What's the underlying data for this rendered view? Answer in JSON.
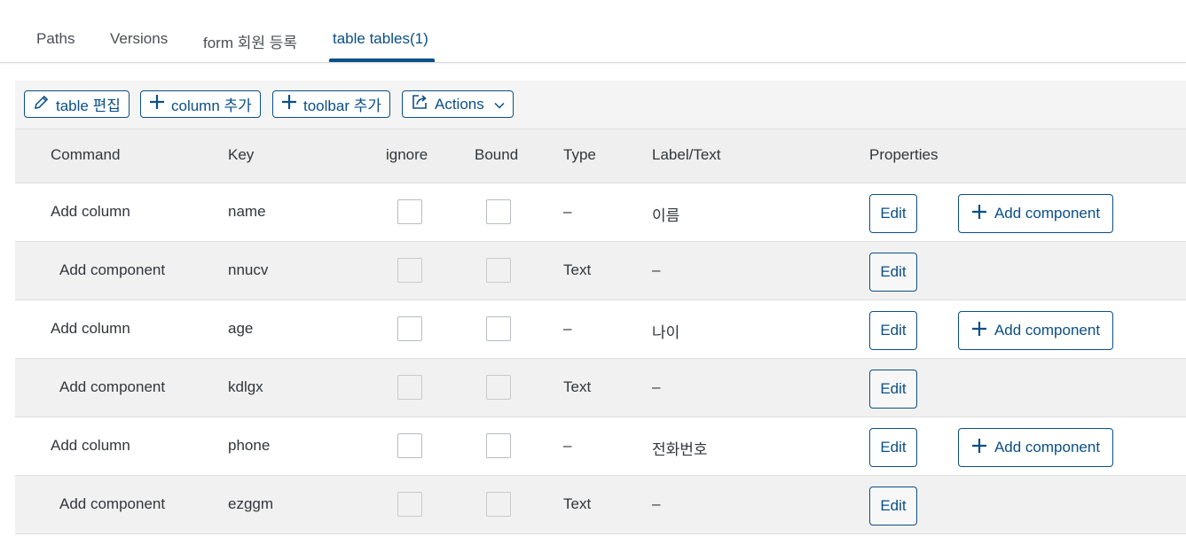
{
  "tabs": [
    {
      "label": "Paths",
      "selected": false
    },
    {
      "label": "Versions",
      "selected": false
    },
    {
      "label": "form 회원 등록",
      "selected": false
    },
    {
      "label": "table tables(1)",
      "selected": true
    }
  ],
  "toolbar": {
    "edit_table_label": "table 편집",
    "add_column_label": "column 추가",
    "add_toolbar_label": "toolbar 추가",
    "actions_label": "Actions"
  },
  "table": {
    "headers": {
      "command": "Command",
      "key": "Key",
      "ignore": "ignore",
      "bound": "Bound",
      "type": "Type",
      "label": "Label/Text",
      "properties": "Properties"
    },
    "edit_label": "Edit",
    "add_component_label": "Add component",
    "rows": [
      {
        "command": "Add column",
        "key": "name",
        "type": "–",
        "label": "이름",
        "ignore": false,
        "bound": false
      },
      {
        "command": "Add component",
        "key": "nnucv",
        "type": "Text",
        "label": "–",
        "ignore": false,
        "bound": false
      },
      {
        "command": "Add column",
        "key": "age",
        "type": "–",
        "label": "나이",
        "ignore": false,
        "bound": false
      },
      {
        "command": "Add component",
        "key": "kdlgx",
        "type": "Text",
        "label": "–",
        "ignore": false,
        "bound": false
      },
      {
        "command": "Add column",
        "key": "phone",
        "type": "–",
        "label": "전화번호",
        "ignore": false,
        "bound": false
      },
      {
        "command": "Add component",
        "key": "ezggm",
        "type": "Text",
        "label": "–",
        "ignore": false,
        "bound": false
      }
    ]
  },
  "colors": {
    "accent": "#0a4f88",
    "header_bg": "#efefef",
    "child_row_bg": "#f1f1f1"
  }
}
